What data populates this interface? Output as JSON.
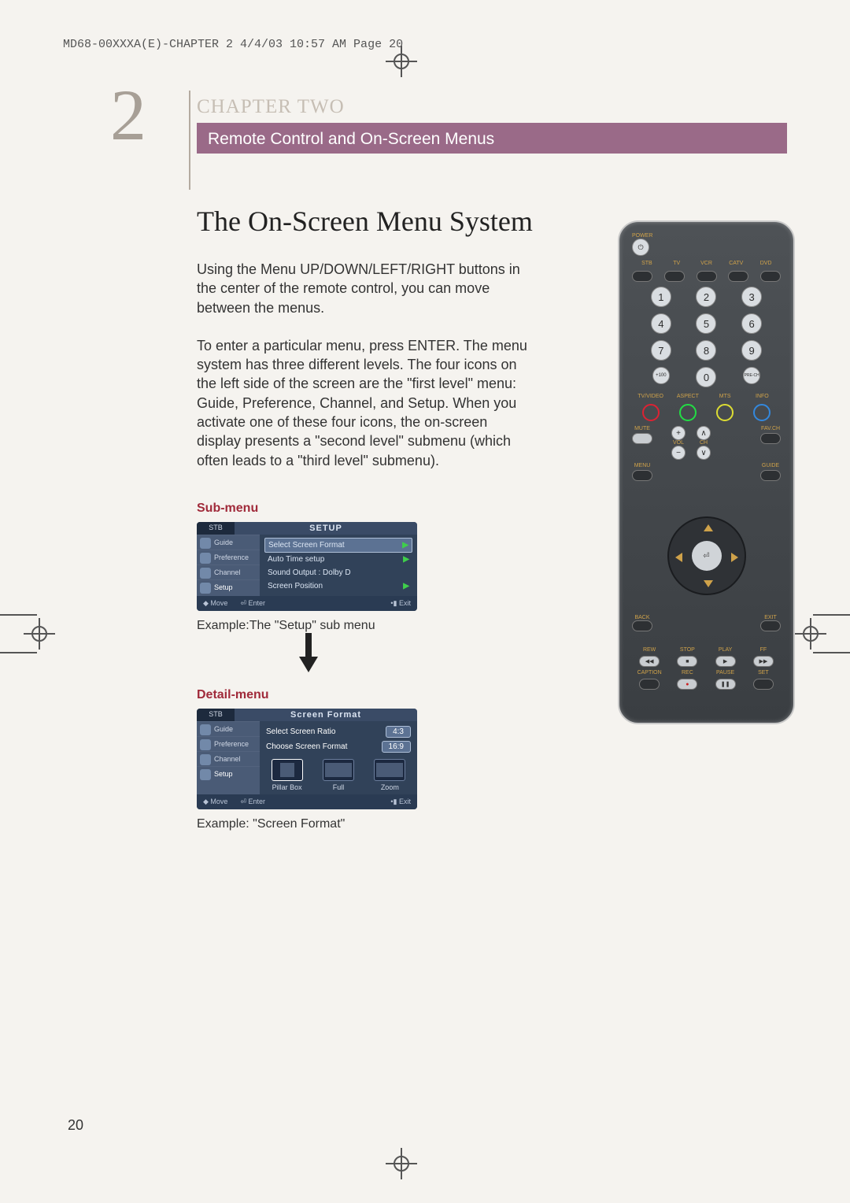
{
  "print_header": "MD68-00XXXA(E)-CHAPTER 2  4/4/03  10:57 AM  Page 20",
  "chapter": {
    "number": "2",
    "label": "CHAPTER TWO",
    "subtitle": "Remote Control and On-Screen Menus"
  },
  "section_heading": "The On-Screen Menu System",
  "para1": "Using the Menu UP/DOWN/LEFT/RIGHT buttons in the center of the remote control, you can move between the menus.",
  "para2": "To enter a particular menu, press ENTER. The menu system has three different levels. The four icons on the left side of the screen are the \"first level\" menu: Guide, Preference, Channel, and Setup. When you activate one of these four icons, the on-screen display presents a \"second level\" submenu (which often leads to a \"third level\" submenu).",
  "submenu_label": "Sub-menu",
  "setup_menu": {
    "stb_tab": "STB",
    "title": "SETUP",
    "side_items": [
      "Guide",
      "Preference",
      "Channel",
      "Setup"
    ],
    "rows": [
      {
        "label": "Select Screen Format",
        "type": "arrow"
      },
      {
        "label": "Auto Time setup",
        "type": "arrow"
      },
      {
        "label": "Sound Output",
        "value": ": Dolby D",
        "type": "value"
      },
      {
        "label": "Screen Position",
        "type": "arrow"
      }
    ],
    "footer": [
      "Move",
      "Enter",
      "Exit"
    ]
  },
  "caption1": "Example:The \"Setup\" sub menu",
  "detail_label": "Detail-menu",
  "detail_menu": {
    "stb_tab": "STB",
    "title": "Screen Format",
    "side_items": [
      "Guide",
      "Preference",
      "Channel",
      "Setup"
    ],
    "row1_label": "Select  Screen Ratio",
    "row1_value": "4:3",
    "row2_label": "Choose Screen Format",
    "row2_value": "16:9",
    "formats": [
      "Pillar Box",
      "Full",
      "Zoom"
    ],
    "footer": [
      "Move",
      "Enter",
      "Exit"
    ]
  },
  "caption2": "Example: \"Screen Format\"",
  "remote": {
    "power": "POWER",
    "device_row": [
      "STB",
      "TV",
      "VCR",
      "CATV",
      "DVD"
    ],
    "digits": [
      "1",
      "2",
      "3",
      "4",
      "5",
      "6",
      "7",
      "8",
      "9",
      "+100",
      "0",
      "PRE-CH"
    ],
    "color_labels": [
      "TV/VIDEO",
      "ASPECT",
      "MTS",
      "INFO"
    ],
    "mute": "MUTE",
    "vol": "VOL",
    "ch": "CH",
    "favch": "FAV.CH",
    "menu": "MENU",
    "guide": "GUIDE",
    "back": "BACK",
    "exit": "EXIT",
    "transport_row1": [
      "REW",
      "STOP",
      "PLAY",
      "FF"
    ],
    "transport_row2": [
      "CAPTION",
      "REC",
      "PAUSE",
      "SET"
    ],
    "enter_glyph": "⏎"
  },
  "page_number": "20"
}
